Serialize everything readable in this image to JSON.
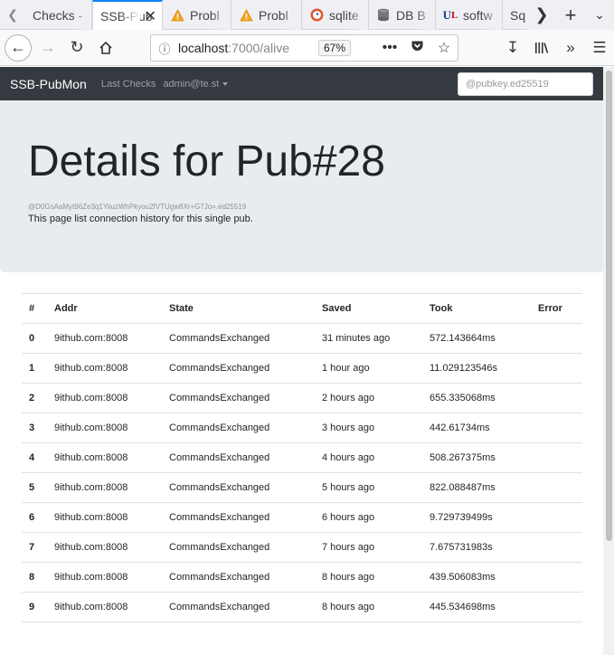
{
  "browser": {
    "tabs": [
      {
        "label": "Checks -",
        "icon": "none"
      },
      {
        "label": "SSB-Pub",
        "icon": "none",
        "active": true
      },
      {
        "label": "Probl",
        "icon": "warning-icon"
      },
      {
        "label": "Probl",
        "icon": "warning-icon"
      },
      {
        "label": "sqlite",
        "icon": "duckduckgo-icon"
      },
      {
        "label": "DB B",
        "icon": "database-icon"
      },
      {
        "label": "softw",
        "icon": "ul-icon"
      },
      {
        "label": "Sq",
        "icon": "none"
      }
    ],
    "url_host": "localhost",
    "url_rest": ":7000/alive",
    "zoom": "67%"
  },
  "site": {
    "brand": "SSB-PubMon",
    "nav_last_checks": "Last Checks",
    "nav_user": "admin@te.st",
    "search_placeholder": "@pubkey.ed25519"
  },
  "header": {
    "title": "Details for Pub#28",
    "pubkey": "@D0GsAaMyt96Ze3q1YiiuzWhPkyou2fVTUgw8Xr+G7Jo=.ed25519",
    "lead": "This page list connection history for this single pub."
  },
  "table": {
    "columns": [
      "#",
      "Addr",
      "State",
      "Saved",
      "Took",
      "Error"
    ],
    "rows": [
      [
        "0",
        "9ithub.com:8008",
        "CommandsExchanged",
        "31 minutes ago",
        "572.143664ms",
        ""
      ],
      [
        "1",
        "9ithub.com:8008",
        "CommandsExchanged",
        "1 hour ago",
        "11.029123546s",
        ""
      ],
      [
        "2",
        "9ithub.com:8008",
        "CommandsExchanged",
        "2 hours ago",
        "655.335068ms",
        ""
      ],
      [
        "3",
        "9ithub.com:8008",
        "CommandsExchanged",
        "3 hours ago",
        "442.61734ms",
        ""
      ],
      [
        "4",
        "9ithub.com:8008",
        "CommandsExchanged",
        "4 hours ago",
        "508.267375ms",
        ""
      ],
      [
        "5",
        "9ithub.com:8008",
        "CommandsExchanged",
        "5 hours ago",
        "822.088487ms",
        ""
      ],
      [
        "6",
        "9ithub.com:8008",
        "CommandsExchanged",
        "6 hours ago",
        "9.729739499s",
        ""
      ],
      [
        "7",
        "9ithub.com:8008",
        "CommandsExchanged",
        "7 hours ago",
        "7.675731983s",
        ""
      ],
      [
        "8",
        "9ithub.com:8008",
        "CommandsExchanged",
        "8 hours ago",
        "439.506083ms",
        ""
      ],
      [
        "9",
        "9ithub.com:8008",
        "CommandsExchanged",
        "8 hours ago",
        "445.534698ms",
        ""
      ]
    ]
  }
}
